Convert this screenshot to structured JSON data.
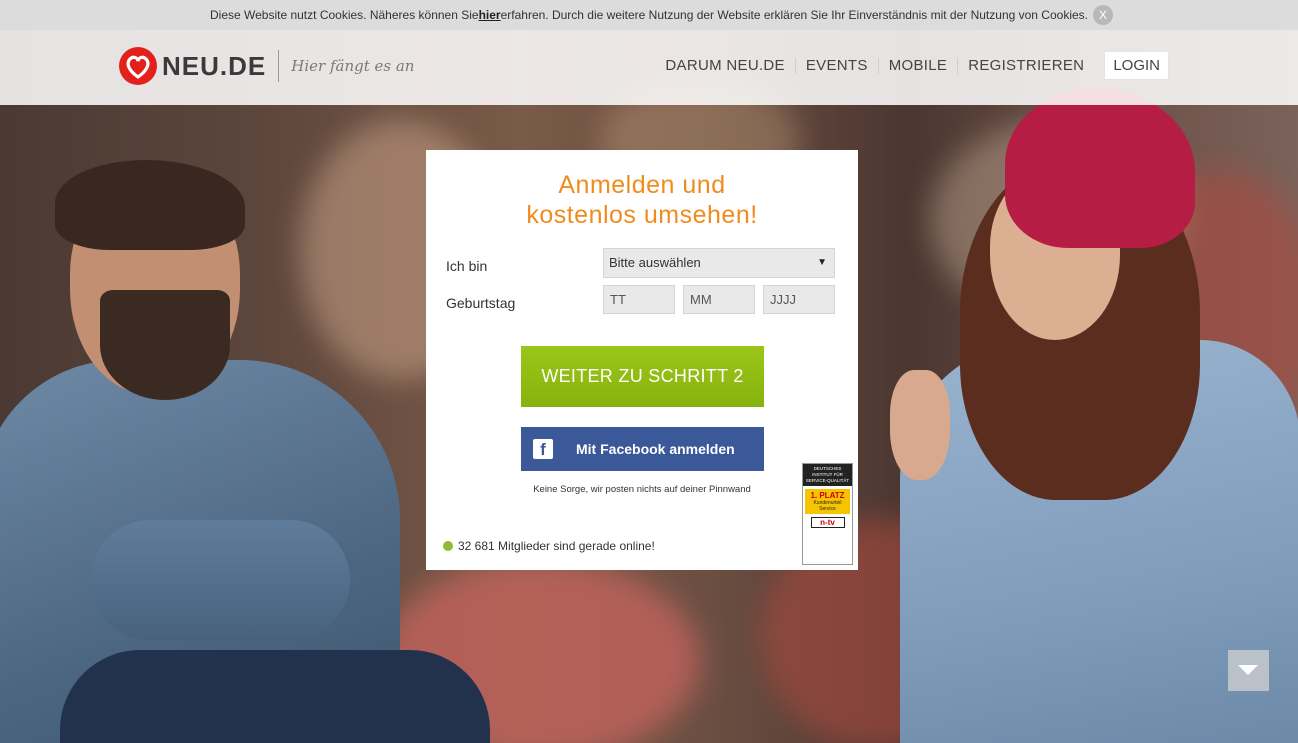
{
  "cookie_bar": {
    "text_before": "Diese Website nutzt Cookies. Näheres können Sie ",
    "link": "hier",
    "text_after": " erfahren. Durch die weitere Nutzung der Website erklären Sie Ihr Einverständnis mit der Nutzung von Cookies.",
    "close": "X"
  },
  "header": {
    "logo_text": "NEU.DE",
    "tagline": "Hier fängt es an",
    "nav": [
      "DARUM NEU.DE",
      "EVENTS",
      "MOBILE",
      "REGISTRIEREN"
    ],
    "login": "LOGIN"
  },
  "form": {
    "title_line1": "Anmelden und",
    "title_line2": "kostenlos umsehen!",
    "iam_label": "Ich bin",
    "iam_value": "Bitte auswählen",
    "birthday_label": "Geburtstag",
    "day_placeholder": "TT",
    "month_placeholder": "MM",
    "year_placeholder": "JJJJ",
    "next_button": "WEITER ZU SCHRITT 2",
    "facebook_button": "Mit Facebook anmelden",
    "facebook_note": "Keine Sorge, wir posten nichts auf deiner Pinnwand",
    "online_text": "32 681 Mitglieder sind gerade online!"
  },
  "seal": {
    "top": "DEUTSCHES INSTITUT FÜR SERVICE-QUALITÄT",
    "rank": "1. PLATZ",
    "label": "Kundenurteil Service",
    "partner": "n-tv"
  },
  "colors": {
    "accent_orange": "#f08b1d",
    "button_green": "#8fbc12",
    "facebook_blue": "#3b5998",
    "logo_red": "#e2211c"
  }
}
